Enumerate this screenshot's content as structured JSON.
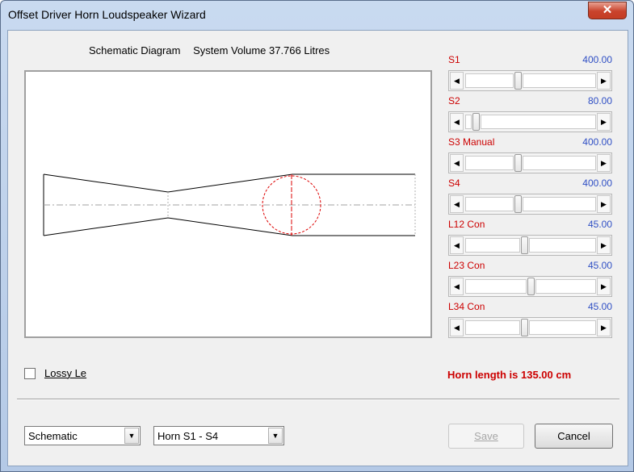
{
  "window": {
    "title": "Offset Driver Horn Loudspeaker Wizard",
    "close_glyph": "✕"
  },
  "diagram": {
    "heading": "Schematic Diagram",
    "volume_text": "System Volume 37.766 Litres"
  },
  "sliders": [
    {
      "label": "S1",
      "value": "400.00",
      "position": 0.5
    },
    {
      "label": "S2",
      "value": "80.00",
      "position": 0.1
    },
    {
      "label": "S3  Manual",
      "value": "400.00",
      "position": 0.5
    },
    {
      "label": "S4",
      "value": "400.00",
      "position": 0.5
    },
    {
      "label": "L12  Con",
      "value": "45.00",
      "position": 0.55
    },
    {
      "label": "L23  Con",
      "value": "45.00",
      "position": 0.6
    },
    {
      "label": "L34  Con",
      "value": "45.00",
      "position": 0.55
    }
  ],
  "lossy_checkbox": {
    "label": "Lossy Le",
    "checked": false
  },
  "horn_length_text": "Horn length is 135.00 cm",
  "combos": {
    "view": {
      "value": "Schematic"
    },
    "section": {
      "value": "Horn S1 - S4"
    }
  },
  "buttons": {
    "save": "Save",
    "cancel": "Cancel"
  },
  "colors": {
    "label_red": "#cc0000",
    "value_blue": "#2f4fc4",
    "driver_circle": "#dd0000"
  }
}
